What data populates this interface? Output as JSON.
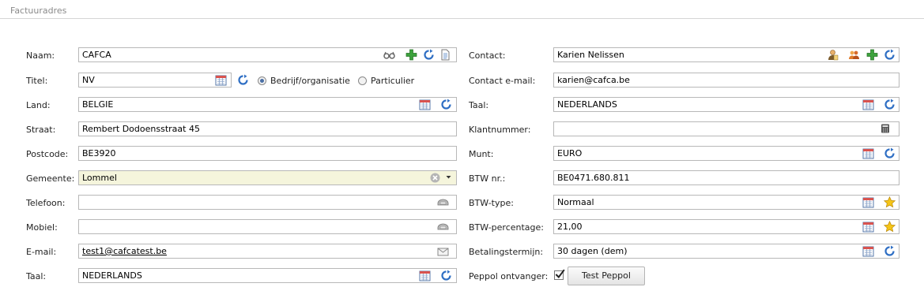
{
  "section": {
    "title": "Factuuradres"
  },
  "left": {
    "naam": {
      "label": "Naam:",
      "value": "CAFCA"
    },
    "titel": {
      "label": "Titel:",
      "value": "NV",
      "radio_company": "Bedrijf/organisatie",
      "radio_private": "Particulier",
      "selected": "Bedrijf/organisatie"
    },
    "land": {
      "label": "Land:",
      "value": "BELGIE"
    },
    "straat": {
      "label": "Straat:",
      "value": "Rembert Dodoensstraat 45"
    },
    "postcode": {
      "label": "Postcode:",
      "value": "BE3920"
    },
    "gemeente": {
      "label": "Gemeente:",
      "value": "Lommel"
    },
    "telefoon": {
      "label": "Telefoon:",
      "value": ""
    },
    "mobiel": {
      "label": "Mobiel:",
      "value": ""
    },
    "email": {
      "label": "E-mail:",
      "value": "test1@cafcatest.be"
    },
    "taal": {
      "label": "Taal:",
      "value": "NEDERLANDS"
    }
  },
  "right": {
    "contact": {
      "label": "Contact:",
      "value": "Karien Nelissen"
    },
    "contact_email": {
      "label": "Contact e-mail:",
      "value": "karien@cafca.be"
    },
    "taal": {
      "label": "Taal:",
      "value": "NEDERLANDS"
    },
    "klantnummer": {
      "label": "Klantnummer:",
      "value": ""
    },
    "munt": {
      "label": "Munt:",
      "value": "EURO"
    },
    "btw_nr": {
      "label": "BTW nr.:",
      "value": "BE0471.680.811"
    },
    "btw_type": {
      "label": "BTW-type:",
      "value": "Normaal"
    },
    "btw_percentage": {
      "label": "BTW-percentage:",
      "value": "21,00"
    },
    "betalingstermijn": {
      "label": "Betalingstermijn:",
      "value": "30 dagen (dem)"
    },
    "peppol": {
      "label": "Peppol ontvanger:",
      "checked": true,
      "button_label": "Test Peppol"
    }
  },
  "colors": {
    "accent": "#2f6fc4",
    "add": "#3ca23c",
    "highlight": "#f5f5dc",
    "border": "#b8b8b8"
  }
}
